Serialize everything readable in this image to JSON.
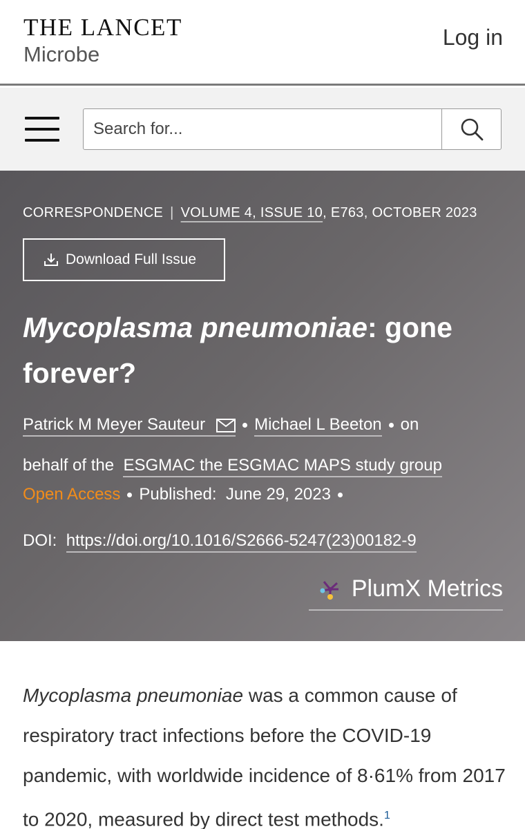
{
  "header": {
    "brand_name": "THE LANCET",
    "brand_sub": "Microbe",
    "login_label": "Log in"
  },
  "search": {
    "placeholder": "Search for..."
  },
  "article_meta": {
    "type": "CORRESPONDENCE",
    "separator": "|",
    "volume": "VOLUME 4, ISSUE 10",
    "pages_date": ", E763, OCTOBER 2023",
    "download_label": "Download Full Issue"
  },
  "title": {
    "italic": "Mycoplasma pneumoniae",
    "rest": ": gone forever?"
  },
  "authors": {
    "author1": "Patrick M Meyer Sauteur",
    "author2": "Michael L Beeton",
    "on": "on",
    "behalf": "behalf of the",
    "group": "ESGMAC the ESGMAC MAPS study group"
  },
  "publication": {
    "access": "Open Access",
    "published_label": "Published:",
    "published_date": "June 29, 2023",
    "doi_label": "DOI:",
    "doi_link": "https://doi.org/10.1016/S2666-5247(23)00182-9",
    "plumx_label": "PlumX Metrics"
  },
  "body": {
    "lead_italic": "Mycoplasma pneumoniae",
    "lead_rest": " was a common cause of respiratory tract infections before the COVID-19 pandemic, with worldwide incidence of 8·61% from 2017 to 2020, measured by direct test methods.",
    "ref": "1"
  },
  "colors": {
    "open_access": "#f28c1a",
    "hero_start": "#58565a",
    "hero_end": "#8a8689",
    "ref_link": "#1a5a96"
  }
}
